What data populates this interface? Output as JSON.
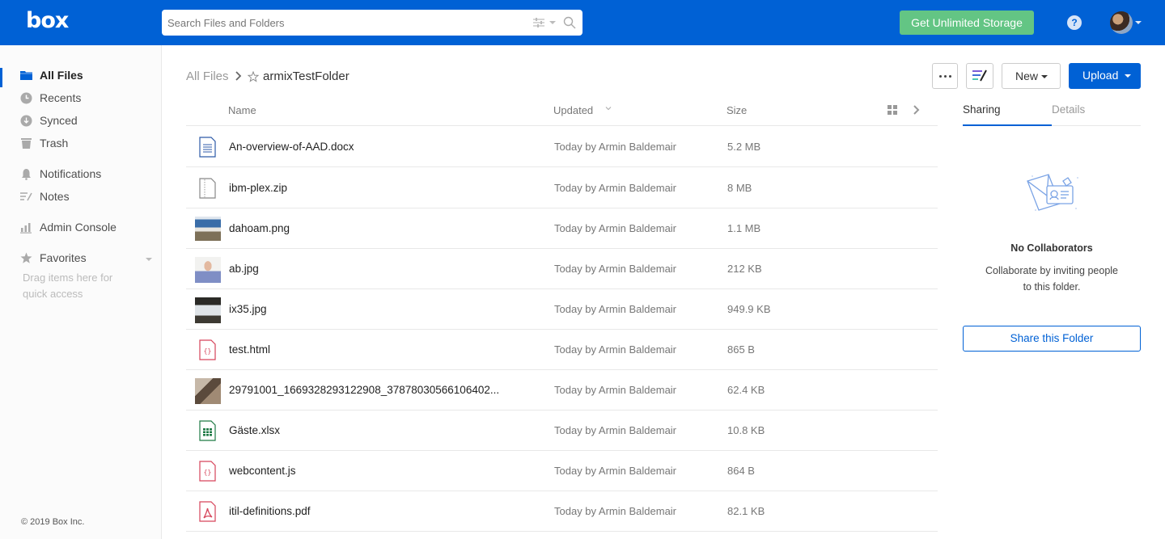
{
  "topbar": {
    "logo": "box",
    "search_placeholder": "Search Files and Folders",
    "search_value": "",
    "storage_button": "Get Unlimited Storage",
    "help_label": "?",
    "brand_color": "#0061d5",
    "storage_color": "#63c584"
  },
  "sidebar": {
    "items": [
      {
        "label": "All Files",
        "icon": "folder-icon",
        "active": true
      },
      {
        "label": "Recents",
        "icon": "clock-icon"
      },
      {
        "label": "Synced",
        "icon": "download-circle-icon"
      },
      {
        "label": "Trash",
        "icon": "trash-icon"
      },
      {
        "label": "Notifications",
        "icon": "bell-icon"
      },
      {
        "label": "Notes",
        "icon": "notes-icon"
      },
      {
        "label": "Admin Console",
        "icon": "bar-chart-icon"
      },
      {
        "label": "Favorites",
        "icon": "star-icon"
      }
    ],
    "favorites_hint": "Drag items here for quick access",
    "copyright": "© 2019 Box Inc."
  },
  "breadcrumb": {
    "root": "All Files",
    "current": "armixTestFolder"
  },
  "toolbar": {
    "new_label": "New",
    "upload_label": "Upload"
  },
  "list": {
    "columns": {
      "name": "Name",
      "updated": "Updated",
      "size": "Size"
    },
    "rows": [
      {
        "name": "An-overview-of-AAD.docx",
        "updated": "Today by Armin Baldemair",
        "size": "5.2 MB",
        "type": "docx"
      },
      {
        "name": "ibm-plex.zip",
        "updated": "Today by Armin Baldemair",
        "size": "8 MB",
        "type": "zip"
      },
      {
        "name": "dahoam.png",
        "updated": "Today by Armin Baldemair",
        "size": "1.1 MB",
        "type": "image"
      },
      {
        "name": "ab.jpg",
        "updated": "Today by Armin Baldemair",
        "size": "212 KB",
        "type": "image"
      },
      {
        "name": "ix35.jpg",
        "updated": "Today by Armin Baldemair",
        "size": "949.9 KB",
        "type": "image"
      },
      {
        "name": "test.html",
        "updated": "Today by Armin Baldemair",
        "size": "865 B",
        "type": "code"
      },
      {
        "name": "29791001_1669328293122908_37878030566106402...",
        "updated": "Today by Armin Baldemair",
        "size": "62.4 KB",
        "type": "image"
      },
      {
        "name": "Gäste.xlsx",
        "updated": "Today by Armin Baldemair",
        "size": "10.8 KB",
        "type": "xlsx"
      },
      {
        "name": "webcontent.js",
        "updated": "Today by Armin Baldemair",
        "size": "864 B",
        "type": "code"
      },
      {
        "name": "itil-definitions.pdf",
        "updated": "Today by Armin Baldemair",
        "size": "82.1 KB",
        "type": "pdf"
      }
    ]
  },
  "sidepanel": {
    "tabs": [
      "Sharing",
      "Details"
    ],
    "active_tab": "Sharing",
    "empty_title": "No Collaborators",
    "empty_desc_line1": "Collaborate by inviting people",
    "empty_desc_line2": "to this folder.",
    "share_button": "Share this Folder"
  }
}
